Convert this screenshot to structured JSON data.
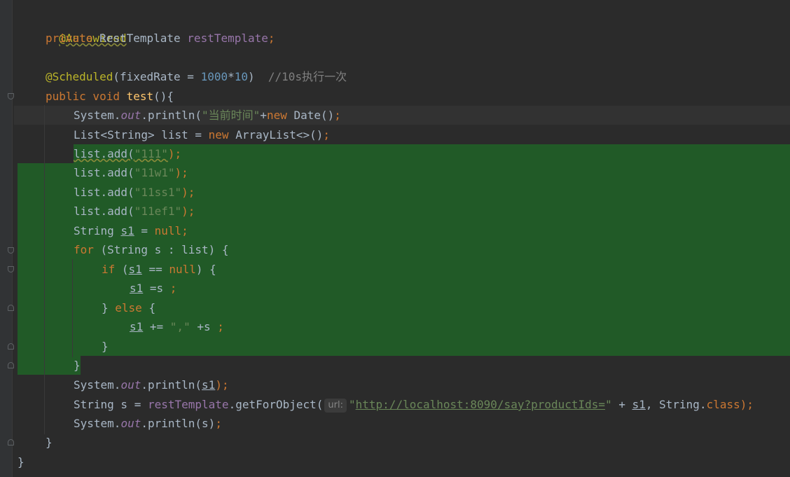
{
  "editor": {
    "lines": {
      "l1": "@Autowired",
      "l2": [
        "private",
        " RestTemplate ",
        "restTemplate",
        ";"
      ],
      "l4": [
        "@Scheduled",
        "(fixedRate = ",
        "1000",
        "*",
        "10",
        ")  ",
        "//10s执行一次"
      ],
      "l5": [
        "public void ",
        "test",
        "(){"
      ],
      "l6": [
        "System.",
        "out",
        ".println(",
        "\"当前时间\"",
        "+",
        "new ",
        "Date()",
        ";"
      ],
      "l7": [
        "List<String> list = ",
        "new ",
        "ArrayList<>()",
        ";"
      ],
      "l8": [
        "list.add(",
        "\"111\"",
        ");"
      ],
      "l9": [
        "list.add(",
        "\"11w1\"",
        ");"
      ],
      "l10": [
        "list.add(",
        "\"11ss1\"",
        ");"
      ],
      "l11": [
        "list.add(",
        "\"11ef1\"",
        ");"
      ],
      "l12": [
        "String ",
        "s1",
        " = ",
        "null",
        ";"
      ],
      "l13": [
        "for ",
        "(String s : list) {"
      ],
      "l14": [
        "if ",
        "(",
        "s1",
        " == ",
        "null",
        ") {"
      ],
      "l15": [
        "s1",
        " =s ",
        ";"
      ],
      "l16": [
        "} ",
        "else ",
        "{"
      ],
      "l17": [
        "s1",
        " += ",
        "\",\"",
        " +s ",
        ";"
      ],
      "l18": "}",
      "l19": "}",
      "l20": [
        "System.",
        "out",
        ".println(",
        "s1",
        ");"
      ],
      "l21": [
        "String s = ",
        "restTemplate",
        ".getForObject(",
        "url:",
        "\"",
        "http://localhost:8090/say?productIds=",
        "\"",
        " + ",
        "s1",
        ", String.",
        "class",
        ");"
      ],
      "l22": [
        "System.",
        "out",
        ".println(s)",
        ";"
      ],
      "l23": "}",
      "l24": "}"
    }
  },
  "colors": {
    "background": "#2b2b2b",
    "keyword": "#cc7832",
    "annotation": "#bbb529",
    "string": "#6a8759",
    "number": "#6897bb",
    "comment": "#808080",
    "field": "#9876aa",
    "method": "#ffc66d",
    "selection": "#215a27"
  }
}
